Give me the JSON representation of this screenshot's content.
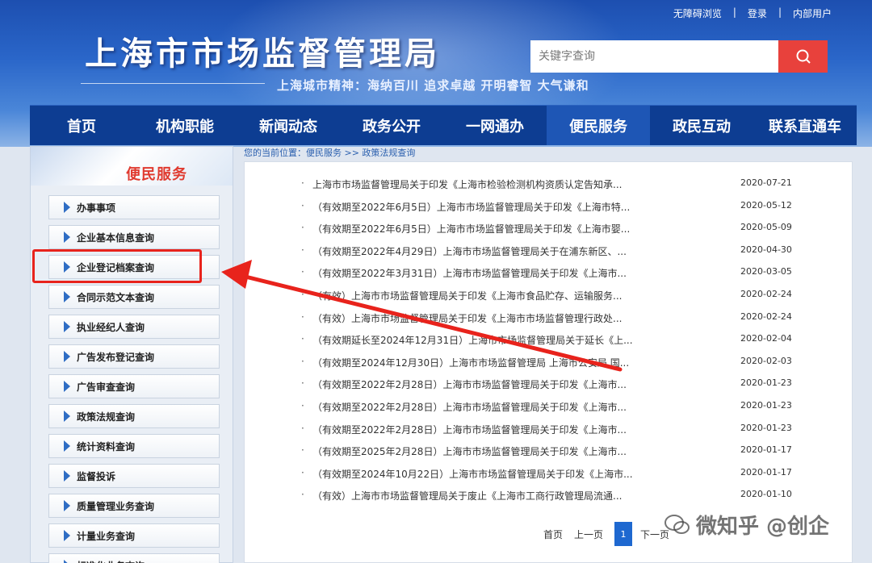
{
  "header": {
    "top_links": [
      "无障碍浏览",
      "登录",
      "内部用户"
    ],
    "separator": "|",
    "site_title": "上海市市场监督管理局",
    "slogan": "上海城市精神：海纳百川  追求卓越  开明睿智  大气谦和",
    "search_placeholder": "关键字查询"
  },
  "nav": {
    "items": [
      "首页",
      "机构职能",
      "新闻动态",
      "政务公开",
      "一网通办",
      "便民服务",
      "政民互动",
      "联系直通车"
    ],
    "active_index": 5
  },
  "sidebar": {
    "title": "便民服务",
    "items": [
      "办事事项",
      "企业基本信息查询",
      "企业登记档案查询",
      "合同示范文本查询",
      "执业经纪人查询",
      "广告发布登记查询",
      "广告审查查询",
      "政策法规查询",
      "统计资料查询",
      "监督投诉",
      "质量管理业务查询",
      "计量业务查询",
      "标准化业务查询"
    ],
    "highlighted_index": 2
  },
  "breadcrumb": {
    "prefix": "您的当前位置：",
    "path": "便民服务 >> 政策法规查询"
  },
  "list": {
    "bullet": "·",
    "rows": [
      {
        "title": "上海市市场监督管理局关于印发《上海市检验检测机构资质认定告知承...",
        "date": "2020-07-21"
      },
      {
        "title": "（有效期至2022年6月5日）上海市市场监督管理局关于印发《上海市特...",
        "date": "2020-05-12"
      },
      {
        "title": "（有效期至2022年6月5日）上海市市场监督管理局关于印发《上海市婴...",
        "date": "2020-05-09"
      },
      {
        "title": "（有效期至2022年4月29日）上海市市场监督管理局关于在浦东新区、...",
        "date": "2020-04-30"
      },
      {
        "title": "（有效期至2022年3月31日）上海市市场监督管理局关于印发《上海市...",
        "date": "2020-03-05"
      },
      {
        "title": "（有效）上海市市场监督管理局关于印发《上海市食品贮存、运输服务...",
        "date": "2020-02-24"
      },
      {
        "title": "（有效）上海市市场监督管理局关于印发《上海市市场监督管理行政处...",
        "date": "2020-02-24"
      },
      {
        "title": "（有效期延长至2024年12月31日）上海市市场监督管理局关于延长《上...",
        "date": "2020-02-04"
      },
      {
        "title": "（有效期至2024年12月30日）上海市市场监督管理局 上海市公安局 国...",
        "date": "2020-02-03"
      },
      {
        "title": "（有效期至2022年2月28日）上海市市场监督管理局关于印发《上海市...",
        "date": "2020-01-23"
      },
      {
        "title": "（有效期至2022年2月28日）上海市市场监督管理局关于印发《上海市...",
        "date": "2020-01-23"
      },
      {
        "title": "（有效期至2022年2月28日）上海市市场监督管理局关于印发《上海市...",
        "date": "2020-01-23"
      },
      {
        "title": "（有效期至2025年2月28日）上海市市场监督管理局关于印发《上海市...",
        "date": "2020-01-17"
      },
      {
        "title": "（有效期至2024年10月22日）上海市市场监督管理局关于印发《上海市...",
        "date": "2020-01-17"
      },
      {
        "title": "（有效）上海市市场监督管理局关于废止《上海市工商行政管理局流通...",
        "date": "2020-01-10"
      }
    ]
  },
  "pager": {
    "first": "首页",
    "prev": "上一页",
    "current": "1",
    "next": "下一页"
  },
  "watermark": "微知乎 @创企",
  "colors": {
    "header_blue": "#1d4fb0",
    "nav_blue": "#0d3d92",
    "search_red": "#e8413c",
    "sidebar_title_red": "#e03a2f",
    "annotation_red": "#e8231c",
    "pager_active": "#1e68d0"
  },
  "icons": [
    "search-icon",
    "arrow-right-icon",
    "triangle-right-icon",
    "annotation-arrow-icon",
    "wechat-icon"
  ]
}
